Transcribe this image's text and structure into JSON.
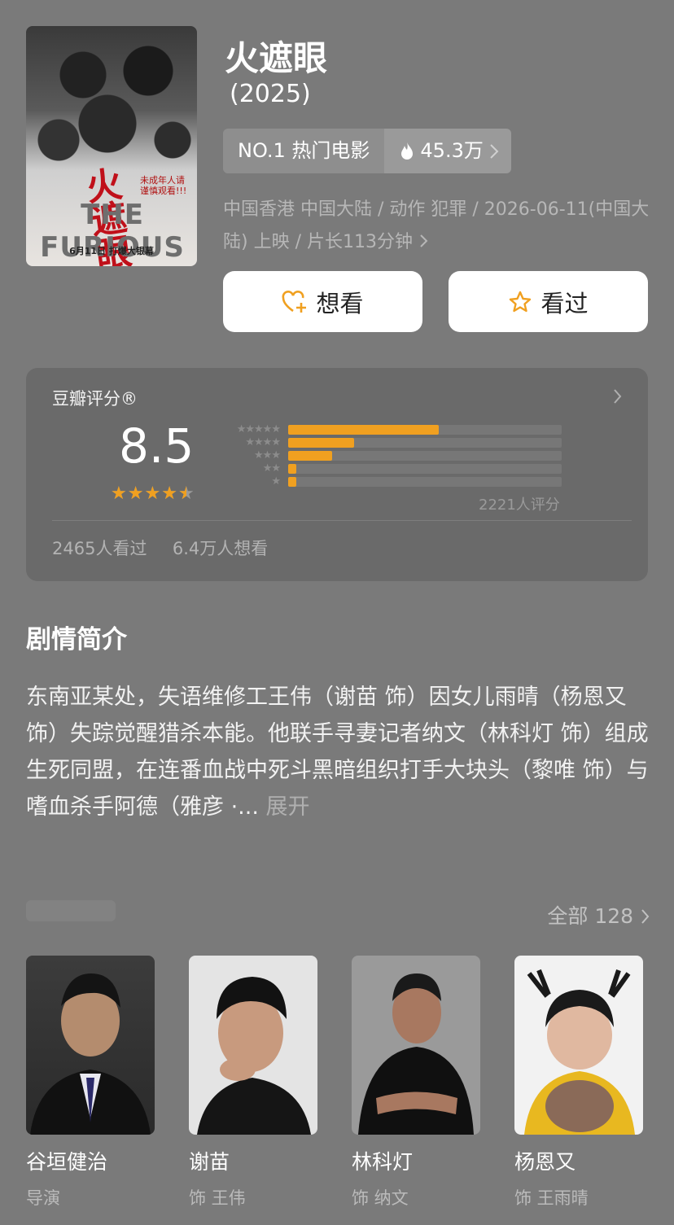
{
  "movie": {
    "title": "火遮眼",
    "year": "(2025)",
    "rank_label": "NO.1 热门电影",
    "heat": "45.3万",
    "meta": "中国香港 中国大陆 / 动作 犯罪 / 2026-06-11(中国大陆) 上映 / 片长113分钟",
    "poster": {
      "title_cn": "火遮眼",
      "title_en": "THE FURIOUS",
      "tagline": "未成年人请谨慎观看!!!",
      "release": "6月11日 打爆大银幕"
    }
  },
  "actions": {
    "want": "想看",
    "seen": "看过"
  },
  "rating": {
    "label": "豆瓣评分®",
    "score": "8.5",
    "stars_value": 4.5,
    "distribution": [
      {
        "stars": "★★★★★",
        "fraction": 0.55
      },
      {
        "stars": "★★★★",
        "fraction": 0.24
      },
      {
        "stars": "★★★",
        "fraction": 0.16
      },
      {
        "stars": "★★",
        "fraction": 0.03
      },
      {
        "stars": "★",
        "fraction": 0.03
      }
    ],
    "count": "2221人评分",
    "seen": "2465人看过",
    "wish": "6.4万人想看"
  },
  "synopsis": {
    "title": "剧情简介",
    "text": "东南亚某处，失语维修工王伟（谢苗 饰）因女儿雨晴（杨恩又 饰）失踪觉醒猎杀本能。他联手寻妻记者纳文（林科灯 饰）组成生死同盟，在连番血战中死斗黑暗组织打手大块头（黎唯 饰）与嗜血杀手阿德（雅彦 ·...",
    "expand": "展开"
  },
  "cast": {
    "all_label": "全部 128",
    "members": [
      {
        "name": "谷垣健治",
        "role": "导演"
      },
      {
        "name": "谢苗",
        "role": "饰 王伟"
      },
      {
        "name": "林科灯",
        "role": "饰 纳文"
      },
      {
        "name": "杨恩又",
        "role": "饰 王雨晴"
      }
    ]
  },
  "colors": {
    "background": "#7a7a7a",
    "card": "#6a6a6a",
    "accent_star": "#f0a020",
    "button_bg": "#ffffff"
  },
  "icons": [
    "heart-plus-icon",
    "star-outline-icon",
    "flame-icon",
    "chevron-right-icon"
  ]
}
